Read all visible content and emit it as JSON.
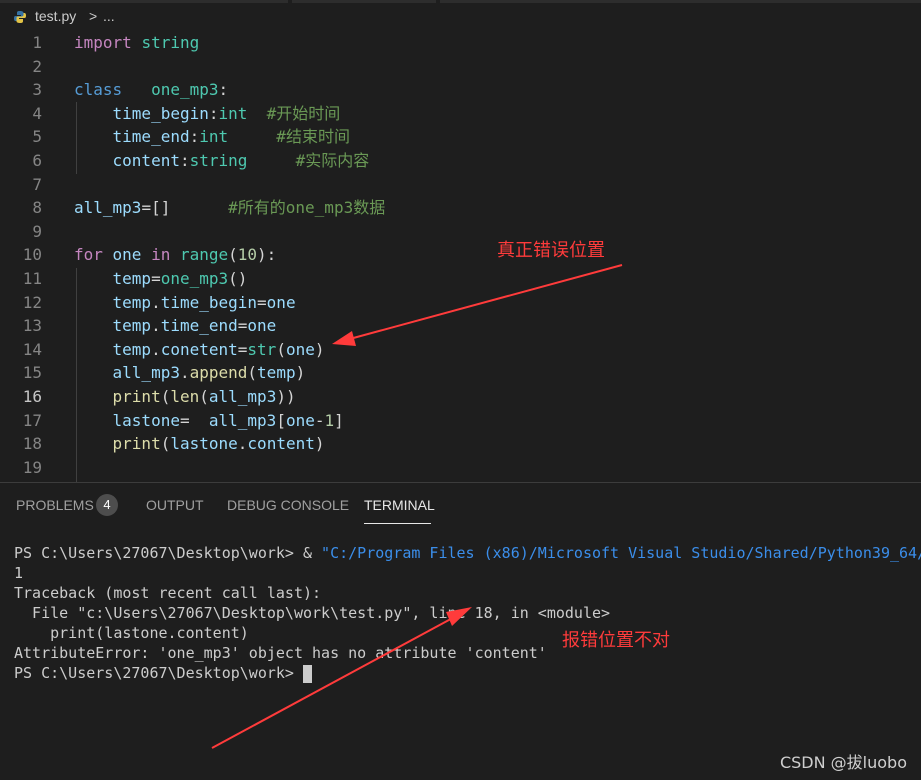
{
  "breadcrumb": {
    "file": "test.py",
    "separator": ">",
    "more": "..."
  },
  "editor": {
    "active_line": "16",
    "lines": [
      {
        "no": "1",
        "tokens": [
          {
            "t": "import ",
            "c": "c"
          },
          {
            "t": "string",
            "c": "cls"
          }
        ]
      },
      {
        "no": "2",
        "tokens": []
      },
      {
        "no": "3",
        "tokens": [
          {
            "t": "class   ",
            "c": "k"
          },
          {
            "t": "one_mp3",
            "c": "cls"
          },
          {
            "t": ":",
            "c": ""
          }
        ]
      },
      {
        "no": "4",
        "tokens": [
          {
            "t": "    ",
            "c": ""
          },
          {
            "t": "time_begin",
            "c": "v"
          },
          {
            "t": ":",
            "c": ""
          },
          {
            "t": "int",
            "c": "cls"
          },
          {
            "t": "  #开始时间",
            "c": "cm"
          }
        ]
      },
      {
        "no": "5",
        "tokens": [
          {
            "t": "    ",
            "c": ""
          },
          {
            "t": "time_end",
            "c": "v"
          },
          {
            "t": ":",
            "c": ""
          },
          {
            "t": "int",
            "c": "cls"
          },
          {
            "t": "     #结束时间",
            "c": "cm"
          }
        ]
      },
      {
        "no": "6",
        "tokens": [
          {
            "t": "    ",
            "c": ""
          },
          {
            "t": "content",
            "c": "v"
          },
          {
            "t": ":",
            "c": ""
          },
          {
            "t": "string",
            "c": "cls"
          },
          {
            "t": "     #实际内容",
            "c": "cm"
          }
        ]
      },
      {
        "no": "7",
        "tokens": []
      },
      {
        "no": "8",
        "tokens": [
          {
            "t": "all_mp3",
            "c": "v"
          },
          {
            "t": "=[]",
            "c": ""
          },
          {
            "t": "      #所有的one_mp3数据",
            "c": "cm"
          }
        ]
      },
      {
        "no": "9",
        "tokens": []
      },
      {
        "no": "10",
        "tokens": [
          {
            "t": "for ",
            "c": "c"
          },
          {
            "t": "one ",
            "c": "v"
          },
          {
            "t": "in ",
            "c": "c"
          },
          {
            "t": "range",
            "c": "cls"
          },
          {
            "t": "(",
            "c": ""
          },
          {
            "t": "10",
            "c": "n"
          },
          {
            "t": "):",
            "c": ""
          }
        ]
      },
      {
        "no": "11",
        "tokens": [
          {
            "t": "    ",
            "c": ""
          },
          {
            "t": "temp",
            "c": "v"
          },
          {
            "t": "=",
            "c": ""
          },
          {
            "t": "one_mp3",
            "c": "cls"
          },
          {
            "t": "()",
            "c": ""
          }
        ]
      },
      {
        "no": "12",
        "tokens": [
          {
            "t": "    ",
            "c": ""
          },
          {
            "t": "temp",
            "c": "v"
          },
          {
            "t": ".",
            "c": ""
          },
          {
            "t": "time_begin",
            "c": "v"
          },
          {
            "t": "=",
            "c": ""
          },
          {
            "t": "one",
            "c": "v"
          }
        ]
      },
      {
        "no": "13",
        "tokens": [
          {
            "t": "    ",
            "c": ""
          },
          {
            "t": "temp",
            "c": "v"
          },
          {
            "t": ".",
            "c": ""
          },
          {
            "t": "time_end",
            "c": "v"
          },
          {
            "t": "=",
            "c": ""
          },
          {
            "t": "one",
            "c": "v"
          }
        ]
      },
      {
        "no": "14",
        "tokens": [
          {
            "t": "    ",
            "c": ""
          },
          {
            "t": "temp",
            "c": "v"
          },
          {
            "t": ".",
            "c": ""
          },
          {
            "t": "conetent",
            "c": "v"
          },
          {
            "t": "=",
            "c": ""
          },
          {
            "t": "str",
            "c": "cls"
          },
          {
            "t": "(",
            "c": ""
          },
          {
            "t": "one",
            "c": "v"
          },
          {
            "t": ")",
            "c": ""
          }
        ]
      },
      {
        "no": "15",
        "tokens": [
          {
            "t": "    ",
            "c": ""
          },
          {
            "t": "all_mp3",
            "c": "v"
          },
          {
            "t": ".",
            "c": ""
          },
          {
            "t": "append",
            "c": "f"
          },
          {
            "t": "(",
            "c": ""
          },
          {
            "t": "temp",
            "c": "v"
          },
          {
            "t": ")",
            "c": ""
          }
        ]
      },
      {
        "no": "16",
        "tokens": [
          {
            "t": "    ",
            "c": ""
          },
          {
            "t": "print",
            "c": "f"
          },
          {
            "t": "(",
            "c": ""
          },
          {
            "t": "len",
            "c": "f"
          },
          {
            "t": "(",
            "c": ""
          },
          {
            "t": "all_mp3",
            "c": "v"
          },
          {
            "t": "))",
            "c": ""
          }
        ]
      },
      {
        "no": "17",
        "tokens": [
          {
            "t": "    ",
            "c": ""
          },
          {
            "t": "lastone",
            "c": "v"
          },
          {
            "t": "=  ",
            "c": ""
          },
          {
            "t": "all_mp3",
            "c": "v"
          },
          {
            "t": "[",
            "c": ""
          },
          {
            "t": "one",
            "c": "v"
          },
          {
            "t": "-",
            "c": ""
          },
          {
            "t": "1",
            "c": "n"
          },
          {
            "t": "]",
            "c": ""
          }
        ]
      },
      {
        "no": "18",
        "tokens": [
          {
            "t": "    ",
            "c": ""
          },
          {
            "t": "print",
            "c": "f"
          },
          {
            "t": "(",
            "c": ""
          },
          {
            "t": "lastone",
            "c": "v"
          },
          {
            "t": ".",
            "c": ""
          },
          {
            "t": "content",
            "c": "v"
          },
          {
            "t": ")",
            "c": ""
          }
        ]
      },
      {
        "no": "19",
        "tokens": []
      }
    ]
  },
  "panel": {
    "tabs": [
      {
        "label": "PROBLEMS",
        "active": false
      },
      {
        "label": "OUTPUT",
        "active": false
      },
      {
        "label": "DEBUG CONSOLE",
        "active": false
      },
      {
        "label": "TERMINAL",
        "active": true
      }
    ],
    "problems_count": "4"
  },
  "terminal": {
    "cmd_prompt": "PS C:\\Users\\27067\\Desktop\\work> & ",
    "cmd_path": "\"C:/Program Files (x86)/Microsoft Visual Studio/Shared/Python39_64/",
    "lines": [
      "1",
      "Traceback (most recent call last):",
      "  File \"c:\\Users\\27067\\Desktop\\work\\test.py\", line 18, in <module>",
      "    print(lastone.content)",
      "AttributeError: 'one_mp3' object has no attribute 'content'"
    ],
    "final_prompt": "PS C:\\Users\\27067\\Desktop\\work> "
  },
  "annotations": {
    "real_error": "真正错误位置",
    "reported_wrong": "报错位置不对",
    "color": "#ff3b3b"
  },
  "watermark": "CSDN @拔luobo"
}
